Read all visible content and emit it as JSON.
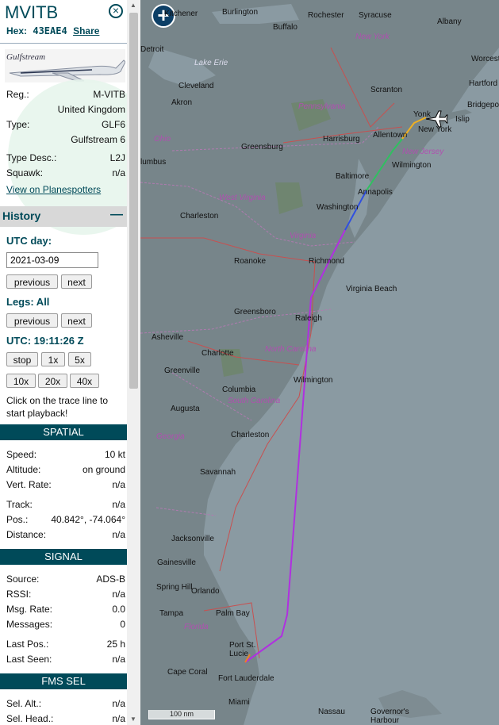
{
  "aircraft": {
    "callsign": "MVITB",
    "hex_label": "Hex:",
    "hex": "43EAE4",
    "share": "Share",
    "logo_text": "Gulfstream",
    "reg_label": "Reg.:",
    "reg": "M-VITB",
    "country": "United Kingdom",
    "type_label": "Type:",
    "type": "GLF6",
    "type_name": "Gulfstream 6",
    "type_desc_label": "Type Desc.:",
    "type_desc": "L2J",
    "squawk_label": "Squawk:",
    "squawk": "n/a",
    "planespotters": "View on Planespotters"
  },
  "history": {
    "title": "History",
    "collapse": "—",
    "utc_day_label": "UTC day:",
    "utc_day": "2021-03-09",
    "previous": "previous",
    "next": "next",
    "legs_label": "Legs: All",
    "utc_time": "UTC: 19:11:26 Z",
    "speed_buttons": [
      "stop",
      "1x",
      "5x",
      "10x",
      "20x",
      "40x"
    ],
    "hint": "Click on the trace line to start playback!"
  },
  "spatial": {
    "title": "SPATIAL",
    "rows": [
      {
        "label": "Speed:",
        "value": "10 kt"
      },
      {
        "label": "Altitude:",
        "value": "on ground"
      },
      {
        "label": "Vert. Rate:",
        "value": "n/a"
      },
      {
        "label": "Track:",
        "value": "n/a"
      },
      {
        "label": "Pos.:",
        "value": "40.842°, -74.064°"
      },
      {
        "label": "Distance:",
        "value": "n/a"
      }
    ]
  },
  "signal": {
    "title": "SIGNAL",
    "rows": [
      {
        "label": "Source:",
        "value": "ADS-B"
      },
      {
        "label": "RSSI:",
        "value": "n/a"
      },
      {
        "label": "Msg. Rate:",
        "value": "0.0"
      },
      {
        "label": "Messages:",
        "value": "0"
      },
      {
        "label": "Last Pos.:",
        "value": "25 h"
      },
      {
        "label": "Last Seen:",
        "value": "n/a"
      }
    ]
  },
  "fms": {
    "title": "FMS SEL",
    "rows": [
      {
        "label": "Sel. Alt.:",
        "value": "n/a"
      },
      {
        "label": "Sel. Head.:",
        "value": "n/a"
      }
    ]
  },
  "map": {
    "scale": "100 nm",
    "zoom_in": "+",
    "labels": {
      "kitchener": "Kitchener",
      "burlington": "Burlington",
      "rochester": "Rochester",
      "syracuse": "Syracuse",
      "albany": "Albany",
      "detroit": "Detroit",
      "buffalo": "Buffalo",
      "new_york_state": "New York",
      "worcester": "Worcester",
      "cleveland": "Cleveland",
      "lake_erie": "Lake Erie",
      "scranton": "Scranton",
      "hartford": "Hartford",
      "pennsylvania": "Pennsylvania",
      "akron": "Akron",
      "bridgeport": "Bridgeport",
      "yonkers": "Yonk",
      "new_york": "New York",
      "islip": "Islip",
      "allentown": "Allentown",
      "ohio": "Ohio",
      "greensburg": "Greensburg",
      "harrisburg": "Harrisburg",
      "new_jersey": "New Jersey",
      "columbus": "lumbus",
      "wilmington_de": "Wilmington",
      "baltimore": "Baltimore",
      "annapolis": "Annapolis",
      "west_virginia": "West Virginia",
      "washington": "Washington",
      "charleston_wv": "Charleston",
      "virginia": "Virginia",
      "roanoke": "Roanoke",
      "richmond": "Richmond",
      "virginia_beach": "Virginia Beach",
      "greensboro": "Greensboro",
      "raleigh": "Raleigh",
      "asheville": "Asheville",
      "north_carolina": "North Carolina",
      "charlotte": "Charlotte",
      "wilmington_nc": "Wilmington",
      "greenville": "Greenville",
      "columbia": "Columbia",
      "south_carolina": "South Carolina",
      "augusta": "Augusta",
      "charleston_sc": "Charleston",
      "georgia": "Georgia",
      "savannah": "Savannah",
      "jacksonville": "Jacksonville",
      "gainesville": "Gainesville",
      "spring_hill": "Spring Hill",
      "orlando": "Orlando",
      "tampa": "Tampa",
      "florida": "Florida",
      "palm_bay": "Palm Bay",
      "port_st_lucie": "Port St. Lucie",
      "cape_coral": "Cape Coral",
      "fort_lauderdale": "Fort Lauderdale",
      "miami": "Miami",
      "nassau": "Nassau",
      "governors_harbour": "Governor's Harbour"
    }
  },
  "colors": {
    "accent": "#004a59",
    "track_purple": "#b030e0",
    "track_blue": "#3050e0",
    "track_green": "#30c060",
    "track_yellow": "#f0b020",
    "track_orange": "#f08020"
  }
}
